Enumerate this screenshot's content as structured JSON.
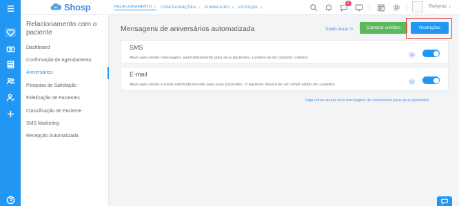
{
  "app": {
    "logo": "Shosp"
  },
  "topnav": [
    {
      "label": "RELACIONAMENTO",
      "active": true
    },
    {
      "label": "CONFIGURAÇÕES",
      "active": false
    },
    {
      "label": "FINANCEIRO",
      "active": false
    },
    {
      "label": "ESTOQUE",
      "active": false
    }
  ],
  "header": {
    "icons": [
      "search-icon",
      "bell-icon",
      "chat-icon",
      "monitor-icon",
      "calendar-icon",
      "gear-icon"
    ],
    "chat_badge": "6",
    "user": "Rahyms"
  },
  "rail": {
    "icons": [
      "menu-icon",
      "heart-icon",
      "money-icon",
      "stack-icon",
      "people-icon",
      "user-edit-icon",
      "plus-icon",
      "help-icon"
    ]
  },
  "submenu": {
    "title": "Relacionamento com o paciente",
    "items": [
      {
        "label": "Dashboard"
      },
      {
        "label": "Confirmação de Agendamento"
      },
      {
        "label": "Aniversários"
      },
      {
        "label": "Pesquisa de Satisfação"
      },
      {
        "label": "Fidelização de Pacientes"
      },
      {
        "label": "Classificação de Paciente"
      },
      {
        "label": "SMS Marketing"
      },
      {
        "label": "Recepção Automatizada"
      }
    ],
    "active_index": 2
  },
  "main": {
    "title": "Mensagens de aniversários automatizada",
    "saldo": "Saldo atual: 0",
    "buy_label": "Comprar créditos",
    "restrictions_label": "Restrições",
    "cards": [
      {
        "title": "SMS",
        "description": "Ative para enviar mensagens automaticamente para seus pacientes. Lembre-se de comprar créditos",
        "enabled": true
      },
      {
        "title": "E-mail",
        "description": "Ative para enviar e-mails automaticamente para seus pacientes. O paciente deverá ter um email válido em cadastro",
        "enabled": true
      }
    ],
    "footer_link": "Veja como enviar uma mensagem de aniversário para seus pacientes"
  },
  "colors": {
    "primary": "#2196f3",
    "success": "#5cb85c",
    "highlight": "#e53935"
  }
}
